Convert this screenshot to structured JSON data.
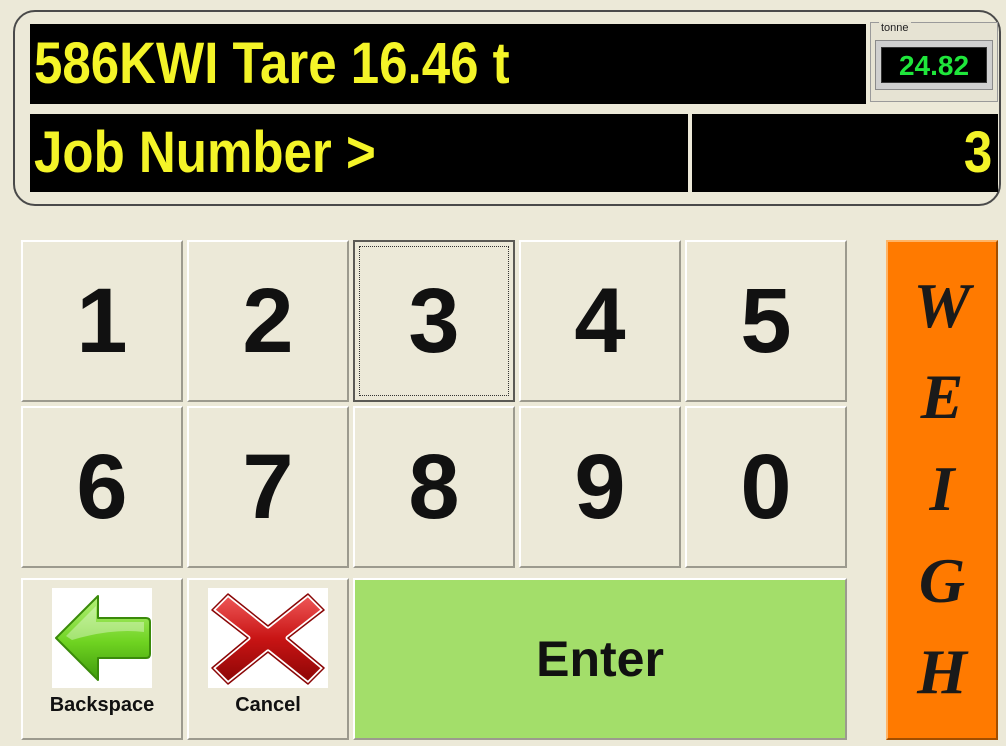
{
  "display": {
    "vehicle_line": "586KWI Tare 16.46 t",
    "prompt_label": "Job Number >",
    "prompt_value": "3"
  },
  "scale": {
    "unit": "tonne",
    "reading": "24.82"
  },
  "keypad": {
    "row1": [
      "1",
      "2",
      "3",
      "4",
      "5"
    ],
    "row2": [
      "6",
      "7",
      "8",
      "9",
      "0"
    ],
    "focused_key": "3"
  },
  "actions": {
    "backspace_label": "Backspace",
    "backspace_icon": "arrow-left-icon",
    "cancel_label": "Cancel",
    "cancel_icon": "close-icon",
    "enter_label": "Enter"
  },
  "weigh": {
    "letters": [
      "W",
      "E",
      "I",
      "G",
      "H"
    ]
  },
  "colors": {
    "lcd_text": "#F4F428",
    "scale_text": "#1FE63B",
    "enter_bg": "#A3DE6A",
    "weigh_bg": "#FF7A00",
    "panel_bg": "#ECE9D8"
  }
}
